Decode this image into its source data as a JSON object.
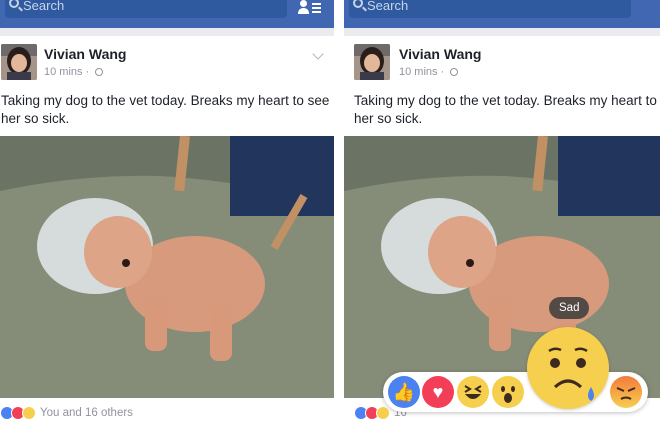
{
  "search": {
    "placeholder": "Search"
  },
  "post": {
    "author": "Vivian Wang",
    "time": "10 mins",
    "separator": "·",
    "text": "Taking my dog to the vet today. Breaks my heart to see her so sick."
  },
  "reactions_summary": {
    "left_text": "You and 16 others",
    "right_text": "16"
  },
  "reaction_picker": {
    "tooltip": "Sad",
    "items": [
      "like",
      "love",
      "haha",
      "wow",
      "sad",
      "angry"
    ]
  },
  "colors": {
    "topbar": "#4267b2",
    "like": "#4b81f0",
    "love": "#f33e58",
    "emoji_yellow": "#f7cf4e",
    "text": "#1d2129",
    "meta": "#90949c"
  }
}
